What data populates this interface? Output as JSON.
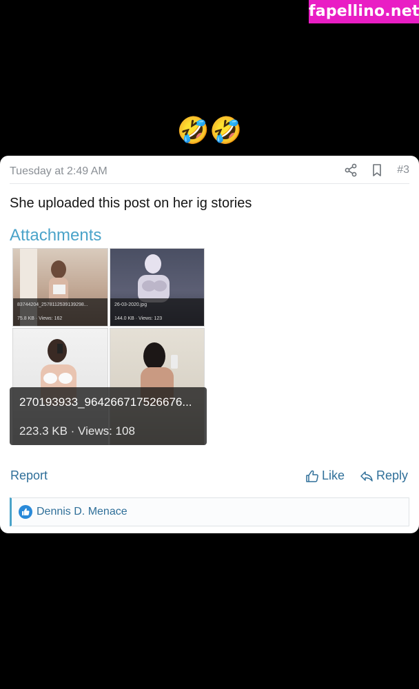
{
  "watermark": "fapellino.net",
  "emojis": "🤣🤣",
  "post": {
    "time": "Tuesday at 2:49 AM",
    "number": "#3",
    "body": "She uploaded this post on her ig stories"
  },
  "attachments": {
    "title": "Attachments",
    "items": [
      {
        "filename": "83744204_2578112539139298...",
        "meta": "75.8 KB · Views: 162"
      },
      {
        "filename": "26-03-2020.jpg",
        "meta": "144.0 KB · Views: 123"
      },
      {
        "filename": "270193933_964266717526676...",
        "meta": "223.3 KB · Views: 108"
      }
    ]
  },
  "actions": {
    "report": "Report",
    "like": "Like",
    "reply": "Reply"
  },
  "reactions": {
    "user": "Dennis D. Menace"
  },
  "colors": {
    "accent": "#4aa3c9",
    "link": "#2f6f99",
    "watermark_bg": "#e91ec4"
  }
}
